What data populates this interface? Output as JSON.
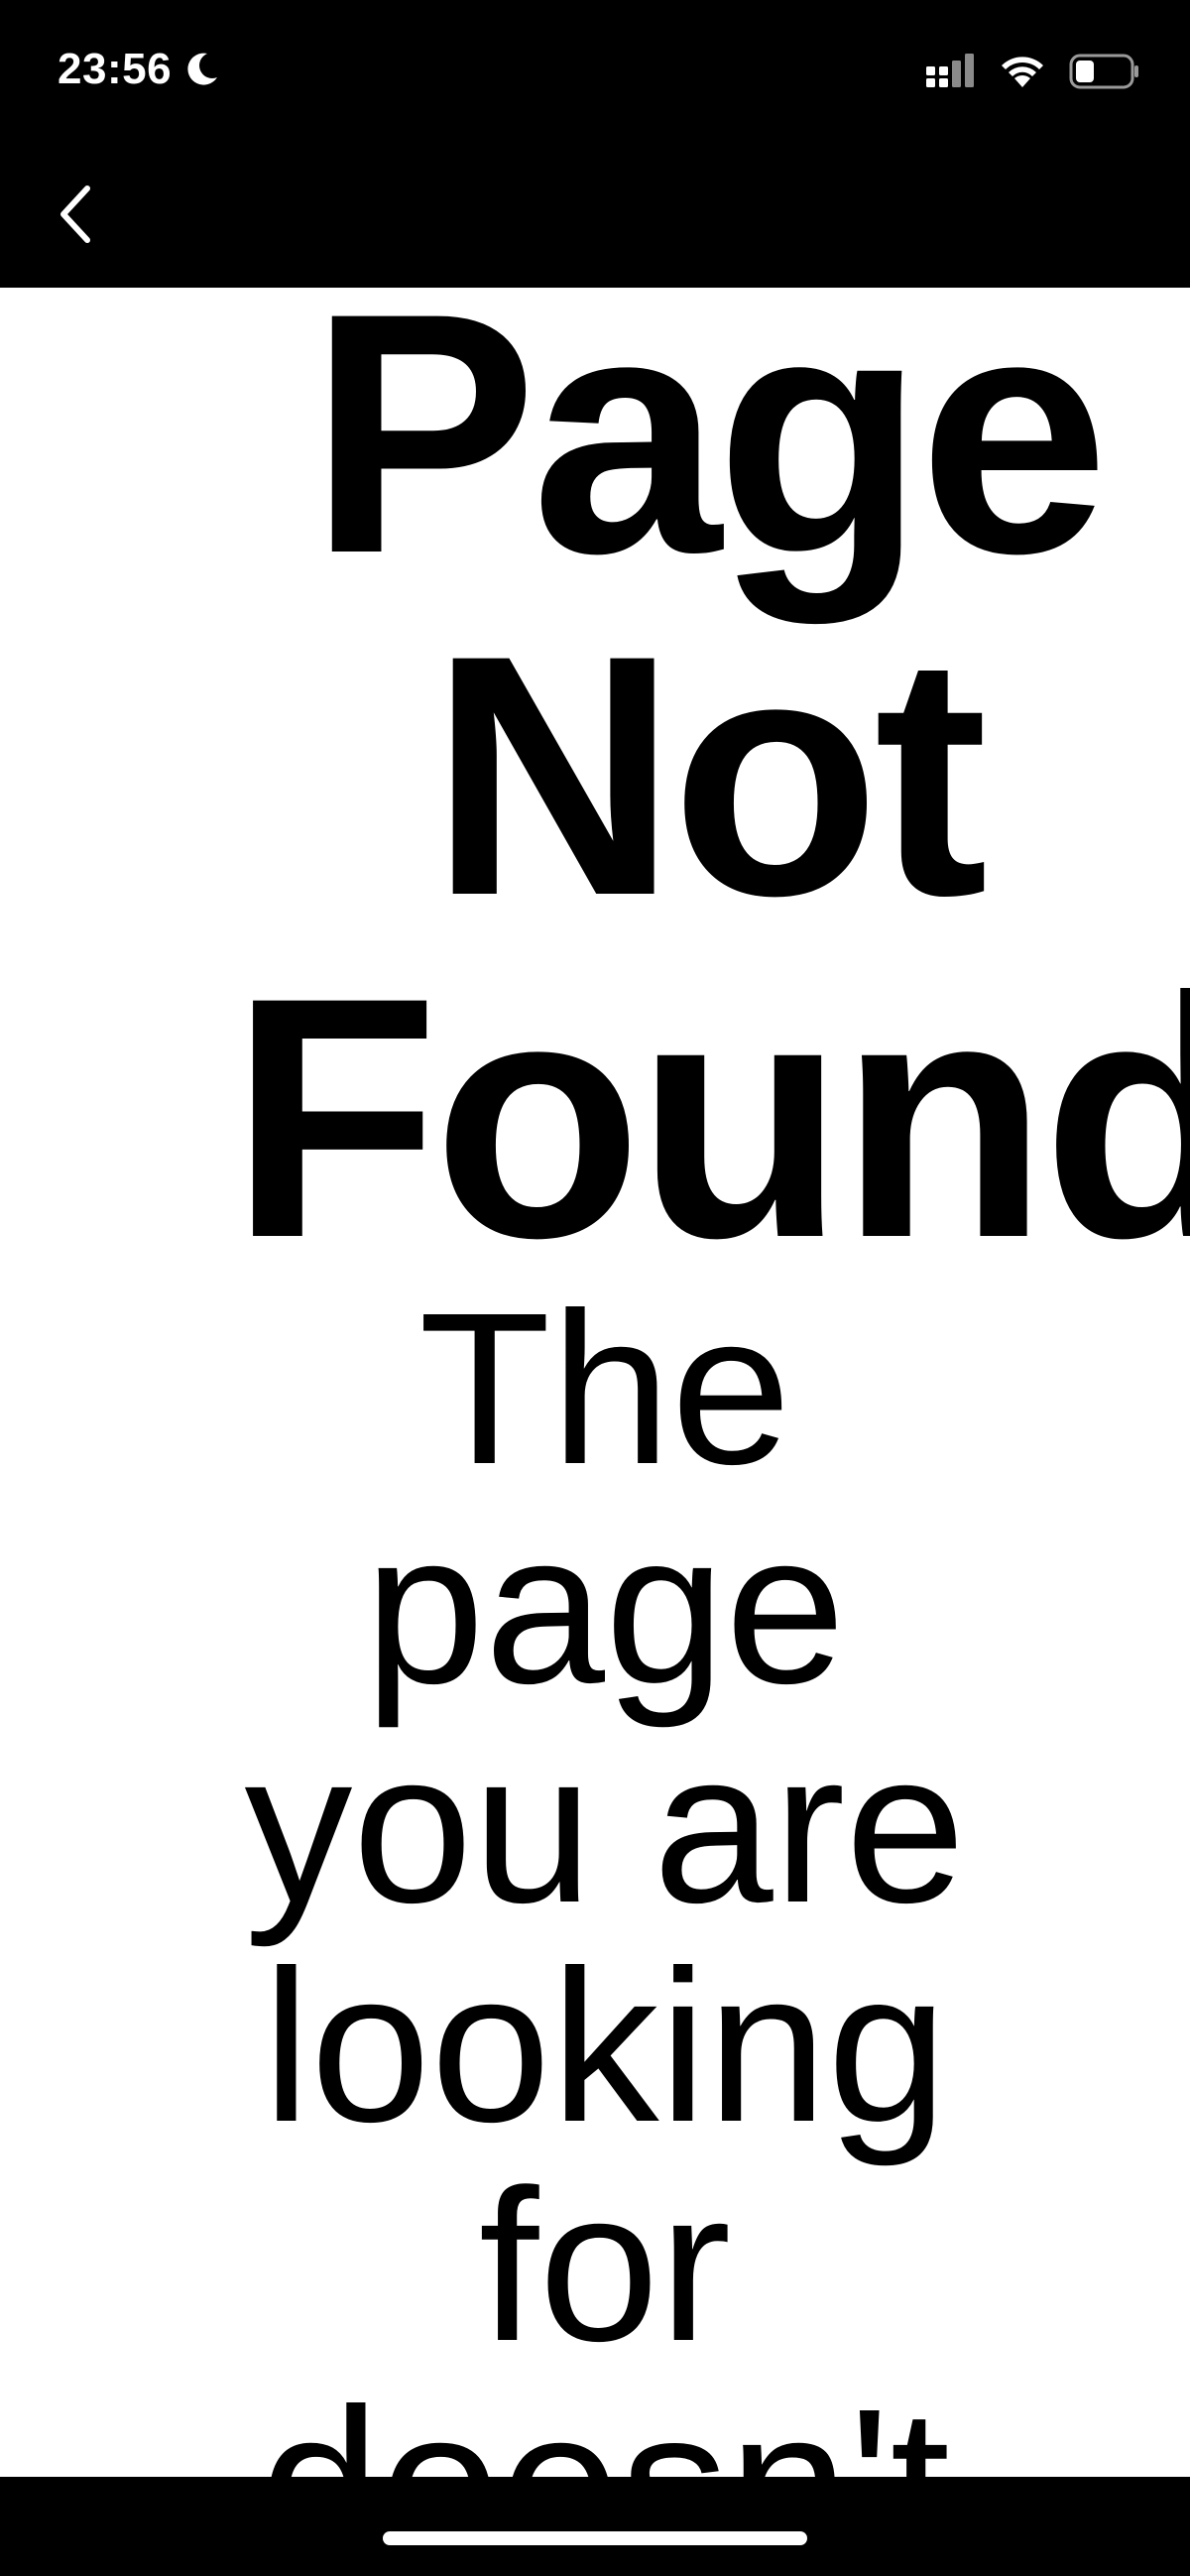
{
  "status_bar": {
    "time": "23:56",
    "moon_icon": "moon-icon",
    "signal_icon": "cellular-signal-icon",
    "wifi_icon": "wifi-icon",
    "battery_icon": "battery-icon",
    "battery_level_fraction": 0.35
  },
  "nav_bar": {
    "back_icon": "chevron-left-icon"
  },
  "content": {
    "title_lines": [
      "Page",
      "Not",
      "Found"
    ],
    "message_lines": [
      "The",
      "page",
      "you are",
      "looking",
      "for",
      "doesn't"
    ]
  },
  "colors": {
    "background": "#ffffff",
    "text": "#000000",
    "bars": "#000000",
    "status_text": "#ffffff"
  }
}
